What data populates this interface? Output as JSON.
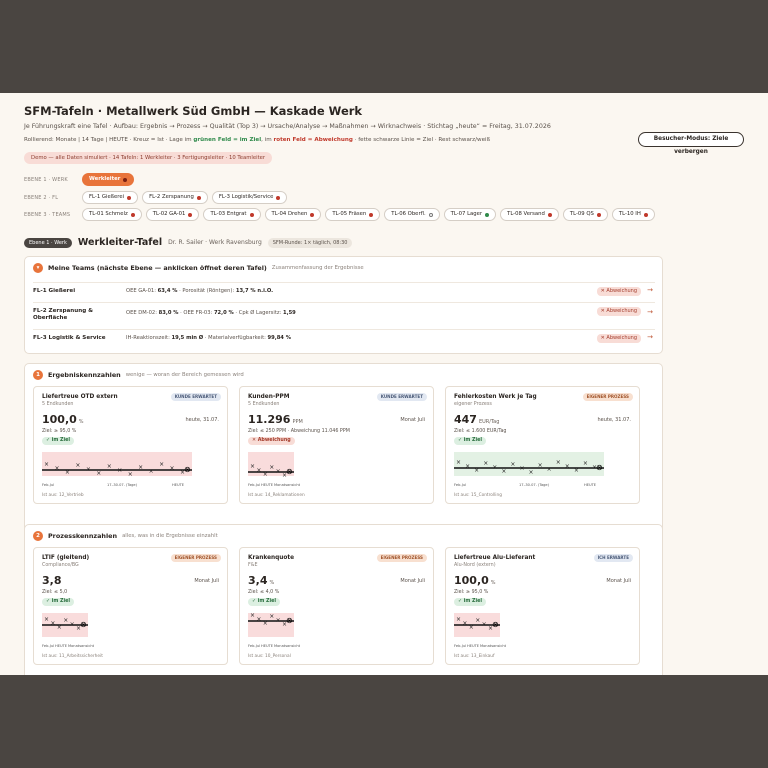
{
  "header": {
    "title": "SFM-Tafeln · Metallwerk Süd GmbH — Kaskade Werk",
    "subtitle": "Je Führungskraft eine Tafel · Aufbau: Ergebnis → Prozess → Qualität (Top 3) → Ursache/Analyse → Maßnahmen → Wirknachweis · Stichtag „heute“ = Freitag, 31.07.2026",
    "legend_a": "Rollierend: Monate | 14 Tage | HEUTE · Kreuz = Ist · Lage im ",
    "legend_green": "grünen Feld = im Ziel",
    "legend_b": ", im ",
    "legend_red": "roten Feld = Abweichung",
    "legend_c": " · fette schwarze Linie = Ziel · Rest schwarz/weiß",
    "hide_button": "Besucher-Modus: Ziele verbergen",
    "demo_note": "Demo — alle Daten simuliert · 14 Tafeln: 1 Werkleiter · 3 Fertigungsleiter · 10 Teamleiter"
  },
  "levels": {
    "l1": "EBENE 1 · WERK",
    "l2": "EBENE 2 · FL",
    "l3": "EBENE 3 · TEAMS",
    "l1_items": [
      {
        "label": "Werkleiter",
        "status": "bad"
      }
    ],
    "l2_items": [
      {
        "label": "FL-1 Gießerei",
        "status": "bad"
      },
      {
        "label": "FL-2 Zerspanung",
        "status": "bad"
      },
      {
        "label": "FL-3 Logistik/Service",
        "status": "bad"
      }
    ],
    "l3_items": [
      {
        "label": "TL-01 Schmelz",
        "status": "bad"
      },
      {
        "label": "TL-02 GA-01",
        "status": "bad"
      },
      {
        "label": "TL-03 Entgrat",
        "status": "bad"
      },
      {
        "label": "TL-04 Drehen",
        "status": "bad"
      },
      {
        "label": "TL-05 Fräsen",
        "status": "bad"
      },
      {
        "label": "TL-06 Oberfl.",
        "status": "none"
      },
      {
        "label": "TL-07 Lager",
        "status": "ok"
      },
      {
        "label": "TL-08 Versand",
        "status": "bad"
      },
      {
        "label": "TL-09 QS",
        "status": "bad"
      },
      {
        "label": "TL-10 IH",
        "status": "bad"
      }
    ]
  },
  "board": {
    "level_tag": "Ebene 1 · Werk",
    "title": "Werkleiter-Tafel",
    "owner": "Dr. R. Sailer · Werk Ravensburg",
    "cadence": "SFM-Runde: 1× täglich, 08:30"
  },
  "teams": {
    "title": "Meine Teams (nächste Ebene — anklicken öffnet deren Tafel)",
    "desc": "Zusammenfassung der Ergebnisse",
    "rows": [
      {
        "name": "FL-1 Gießerei",
        "info_a": "OEE GA-01: ",
        "info_b": "63,4 %",
        "info_c": " · Porosität (Röntgen): ",
        "info_d": "13,7 % n.i.O.",
        "status": "✕ Abweichung"
      },
      {
        "name": "FL-2 Zerspanung & Oberfläche",
        "info_a": "OEE DM-02: ",
        "info_b": "83,0 %",
        "info_c": " · OEE FR-03: ",
        "info_d": "72,0 %",
        "info_e": " · Cpk Ø Lagersitz: ",
        "info_f": "1,59",
        "status": "✕ Abweichung"
      },
      {
        "name": "FL-3 Logistik & Service",
        "info_a": "IH-Reaktionszeit: ",
        "info_b": "19,5 min Ø",
        "info_c": " · Materialverfügbarkeit: ",
        "info_d": "99,84 %",
        "status": "✕ Abweichung"
      }
    ]
  },
  "results": {
    "num": "1",
    "title": "Ergebniskennzahlen",
    "desc": "wenige — woran der Bereich gemessen wird",
    "cards": [
      {
        "title": "Liefertreue OTD extern",
        "sub": "5 Endkunden",
        "type": "KUNDE ERWARTET",
        "type_class": "kunde",
        "value": "100,0",
        "unit": "%",
        "date": "heute, 31.07.",
        "goal": "Ziel: ≥ 95,0 %",
        "status": "✓ im Ziel",
        "status_class": "ok",
        "footer": "Ist aus: 12_Vertrieb",
        "axis_left": "Feb-Jul",
        "axis_mid": "17–30.07. (Tage)",
        "axis_right": "HEUTE"
      },
      {
        "title": "Kunden-PPM",
        "sub": "5 Endkunden",
        "type": "KUNDE ERWARTET",
        "type_class": "kunde",
        "value": "11.296",
        "unit": "PPM",
        "date": "Monat Juli",
        "goal": "Ziel: ≤ 250 PPM · Abweichung 11.046 PPM",
        "status": "✕ Abweichung",
        "status_class": "bad",
        "footer": "Ist aus: 14_Reklamationen",
        "axis_left": "Feb-Jul",
        "axis_mid": "HEUTE",
        "axis_right": "Monatsansicht"
      },
      {
        "title": "Fehlerkosten Werk je Tag",
        "sub": "eigener Prozess",
        "type": "EIGENER PROZESS",
        "type_class": "eigen",
        "value": "447",
        "unit": "EUR/Tag",
        "date": "heute, 31.07.",
        "goal": "Ziel: ≤ 1.600 EUR/Tag",
        "status": "✓ im Ziel",
        "status_class": "ok",
        "footer": "Ist aus: 15_Controlling",
        "axis_left": "Feb-Jul",
        "axis_mid": "17–30.07. (Tage)",
        "axis_right": "HEUTE"
      }
    ]
  },
  "process": {
    "num": "2",
    "title": "Prozesskennzahlen",
    "desc": "alles, was in die Ergebnisse einzahlt",
    "cards": [
      {
        "title": "LTIF (gleitend)",
        "sub": "Compliance/BG",
        "type": "EIGENER PROZESS",
        "type_class": "eigen",
        "value": "3,8",
        "unit": "",
        "date": "Monat Juli",
        "goal": "Ziel: ≤ 5,0",
        "status": "✓ im Ziel",
        "status_class": "ok",
        "footer": "Ist aus: 11_Arbeitssicherheit",
        "axis_left": "Feb-Jul",
        "axis_mid": "HEUTE",
        "axis_right": "Monatsansicht"
      },
      {
        "title": "Krankenquote",
        "sub": "F&E",
        "type": "EIGENER PROZESS",
        "type_class": "eigen",
        "value": "3,4",
        "unit": "%",
        "date": "Monat Juli",
        "goal": "Ziel: ≤ 4,0 %",
        "status": "✓ im Ziel",
        "status_class": "ok",
        "footer": "Ist aus: 10_Personal",
        "axis_left": "Feb-Jul",
        "axis_mid": "HEUTE",
        "axis_right": "Monatsansicht"
      },
      {
        "title": "Liefertreue Alu-Lieferant",
        "sub": "Alu-Nord (extern)",
        "type": "ICH ERWARTE",
        "type_class": "kunde",
        "value": "100,0",
        "unit": "%",
        "date": "Monat Juli",
        "goal": "Ziel: ≥ 95,0 %",
        "status": "✓ im Ziel",
        "status_class": "ok",
        "footer": "Ist aus: 13_Einkauf",
        "axis_left": "Feb-Jul",
        "axis_mid": "HEUTE",
        "axis_right": "Monatsansicht"
      }
    ]
  },
  "colors": {
    "accent": "#e8743b",
    "ok_zone": "#e3f1e4",
    "bad_zone": "#f9dcdc",
    "bad": "#c0392b",
    "ok": "#2f8a4b"
  }
}
